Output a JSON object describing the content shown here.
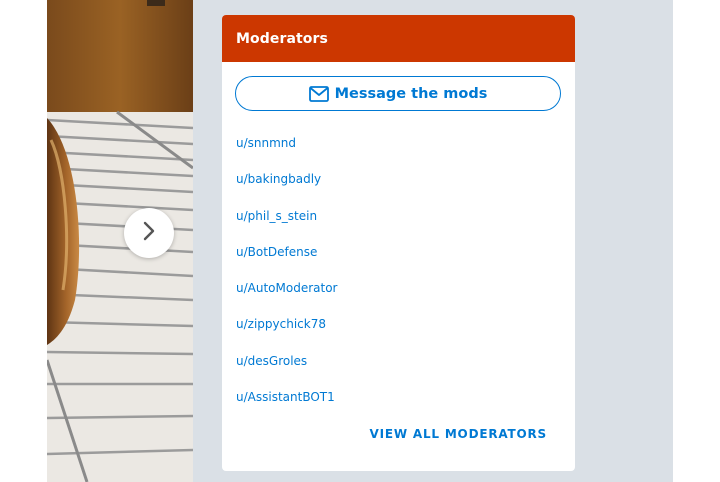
{
  "widget": {
    "title": "Moderators",
    "message_button_label": "Message the mods",
    "moderators": [
      "u/snnmnd",
      "u/bakingbadly",
      "u/phil_s_stein",
      "u/BotDefense",
      "u/AutoModerator",
      "u/zippychick78",
      "u/desGroles",
      "u/AssistantBOT1"
    ],
    "view_all_label": "VIEW ALL MODERATORS"
  },
  "icons": {
    "message": "mail-icon",
    "next": "chevron-right-icon"
  },
  "colors": {
    "header": "#cc3700",
    "link": "#0079d3",
    "page_bg": "#dae0e6"
  }
}
